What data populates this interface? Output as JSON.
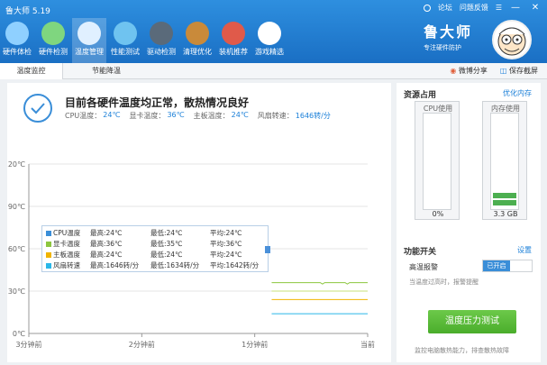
{
  "app": {
    "title": "鲁大师 5.19"
  },
  "titlebar": {
    "forum": "论坛",
    "feedback": "问题反馈",
    "minimize": "—",
    "close": "✕"
  },
  "nav": [
    {
      "label": "硬件体检",
      "icon": "monitor-icon",
      "color": "#8fd0ff"
    },
    {
      "label": "硬件检测",
      "icon": "chip-icon",
      "color": "#7fd67f"
    },
    {
      "label": "温度管理",
      "icon": "temperature-icon",
      "color": "#e0f0ff"
    },
    {
      "label": "性能测试",
      "icon": "speedometer-icon",
      "color": "#6fc3f0"
    },
    {
      "label": "驱动检测",
      "icon": "driver-icon",
      "color": "#5a6a7a"
    },
    {
      "label": "清理优化",
      "icon": "broom-icon",
      "color": "#c98a3a"
    },
    {
      "label": "装机推荐",
      "icon": "cube-icon",
      "color": "#e05a4a"
    },
    {
      "label": "游戏精选",
      "icon": "gamepad-icon",
      "color": "#ffffff"
    }
  ],
  "brand": {
    "name": "鲁大师",
    "slogan": "专注硬件防护"
  },
  "subtabs": {
    "temp_monitor": "温度监控",
    "power_saving": "节能降温"
  },
  "share": {
    "weibo": "微博分享",
    "screenshot": "保存截屏"
  },
  "status": {
    "title": "目前各硬件温度均正常，散热情况良好",
    "items": [
      {
        "label": "CPU温度：",
        "value": "24℃"
      },
      {
        "label": "显卡温度：",
        "value": "36℃"
      },
      {
        "label": "主板温度：",
        "value": "24℃"
      },
      {
        "label": "风扇转速：",
        "value": "1646转/分"
      }
    ]
  },
  "legend": [
    {
      "name": "CPU温度",
      "color": "#3a8ed8",
      "max": "最高:24℃",
      "min": "最低:24℃",
      "avg": "平均:24℃"
    },
    {
      "name": "显卡温度",
      "color": "#8cc63f",
      "max": "最高:36℃",
      "min": "最低:35℃",
      "avg": "平均:36℃"
    },
    {
      "name": "主板温度",
      "color": "#f0b400",
      "max": "最高:24℃",
      "min": "最低:24℃",
      "avg": "平均:24℃"
    },
    {
      "name": "风扇转速",
      "color": "#2ab7e8",
      "max": "最高:1646转/分",
      "min": "最低:1634转/分",
      "avg": "平均:1642转/分"
    }
  ],
  "chart_data": {
    "type": "line",
    "ylim": [
      0,
      120
    ],
    "yticks": [
      "0℃",
      "30℃",
      "60℃",
      "90℃",
      "120℃"
    ],
    "xticks": [
      "3分钟前",
      "2分钟前",
      "1分钟前",
      "当前"
    ],
    "xlim": [
      -3,
      0
    ],
    "series": [
      {
        "name": "CPU温度",
        "color": "#f0b400",
        "x": [
          -0.85,
          0
        ],
        "y": [
          24,
          24
        ]
      },
      {
        "name": "显卡温度",
        "color": "#8cc63f",
        "x": [
          -0.85,
          -0.42,
          -0.4,
          -0.38,
          -0.2,
          -0.18,
          -0.16,
          0
        ],
        "y": [
          36,
          36,
          35,
          36,
          36,
          35,
          36,
          36
        ]
      },
      {
        "name": "主板温度",
        "color": "#c9e07a",
        "x": [
          -0.85,
          0
        ],
        "y": [
          30,
          30
        ]
      },
      {
        "name": "风扇转速",
        "color": "#2ab7e8",
        "x": [
          -0.85,
          0
        ],
        "y": [
          14,
          14
        ]
      }
    ]
  },
  "resources": {
    "title": "资源占用",
    "optimize": "优化内存",
    "cpu_label": "CPU使用",
    "cpu_value": "0%",
    "cpu_level": 0.0,
    "mem_label": "内存使用",
    "mem_value": "3.3 GB",
    "mem_level": 0.2
  },
  "features": {
    "title": "功能开关",
    "settings": "设置",
    "alarm_label": "高温报警",
    "alarm_state": "已开启",
    "alarm_note": "当温度过高时，报警提醒"
  },
  "stress": {
    "button": "温度压力测试",
    "note": "监控电脑散热能力，排查散热故障"
  }
}
